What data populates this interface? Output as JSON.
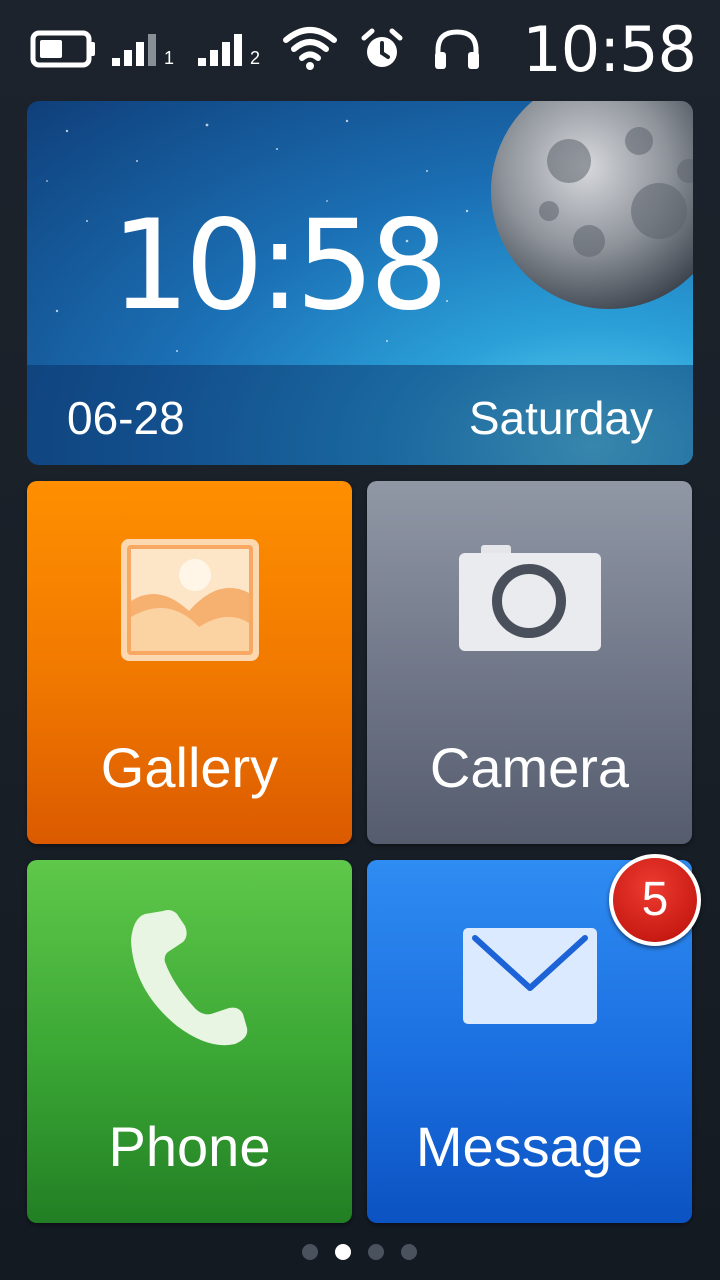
{
  "status_bar": {
    "time": "10:58",
    "sim1_label": "1",
    "sim2_label": "2",
    "icons": [
      "battery-icon",
      "signal-sim1-icon",
      "signal-sim2-icon",
      "wifi-icon",
      "alarm-icon",
      "headphones-icon"
    ]
  },
  "clock_widget": {
    "time": "10:58",
    "date": "06-28",
    "day": "Saturday"
  },
  "tiles": [
    {
      "label": "Gallery",
      "icon": "gallery-icon",
      "color": "#f07800"
    },
    {
      "label": "Camera",
      "icon": "camera-icon",
      "color": "#6f7687"
    },
    {
      "label": "Phone",
      "icon": "phone-icon",
      "color": "#3aa634"
    },
    {
      "label": "Message",
      "icon": "envelope-icon",
      "color": "#1b6fe0",
      "badge": "5"
    }
  ],
  "pager": {
    "page_count": 4,
    "active_page": 2
  }
}
